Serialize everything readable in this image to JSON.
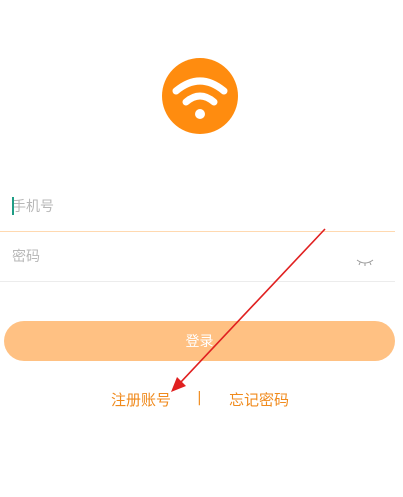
{
  "app": {
    "logo_icon": "wifi-icon",
    "accent_color": "#ff8c0f"
  },
  "login_form": {
    "phone_placeholder": "手机号",
    "password_placeholder": "密码",
    "password_toggle_icon": "eye-closed-icon",
    "login_label": "登录"
  },
  "footer_links": {
    "register_label": "注册账号",
    "divider": "|",
    "forgot_label": "忘记密码"
  },
  "annotation": {
    "arrow_color": "#e02020"
  }
}
